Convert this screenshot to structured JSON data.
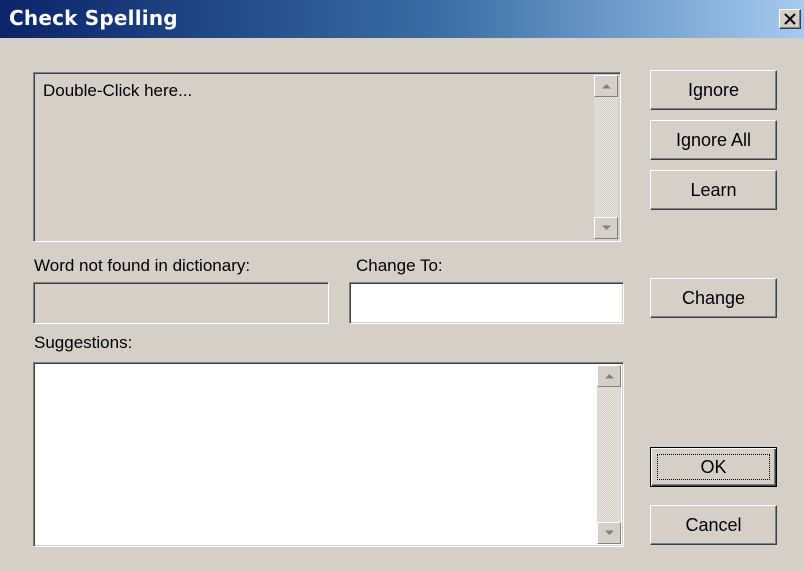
{
  "window": {
    "title": "Check Spelling",
    "close_icon": "close-icon"
  },
  "context_area": {
    "text": "Double-Click here..."
  },
  "labels": {
    "word_not_found": "Word not found in dictionary:",
    "change_to": "Change To:",
    "suggestions": "Suggestions:"
  },
  "fields": {
    "word_not_found_value": "",
    "change_to_value": ""
  },
  "suggestions": [],
  "buttons": {
    "ignore": "Ignore",
    "ignore_all": "Ignore All",
    "learn": "Learn",
    "change": "Change",
    "ok": "OK",
    "cancel": "Cancel"
  },
  "colors": {
    "face": "#d4d0c8",
    "title_start": "#0a246a",
    "title_end": "#a6caf0"
  }
}
